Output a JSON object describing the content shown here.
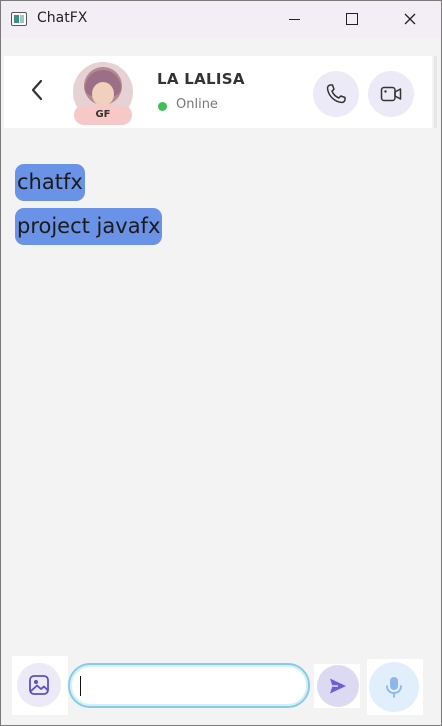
{
  "window": {
    "title": "ChatFX"
  },
  "contact": {
    "name": "LA LALISA",
    "status": "Online",
    "avatar_badge": "GF"
  },
  "messages": [
    {
      "text": "chatfx"
    },
    {
      "text": "project javafx"
    }
  ],
  "composer": {
    "input_value": ""
  },
  "colors": {
    "bubble": "#6a92e6",
    "online": "#3cc15a",
    "icon_accent": "#6b5fd8",
    "input_border": "#84cce9"
  },
  "icons": [
    "back-icon",
    "phone-icon",
    "video-icon",
    "image-icon",
    "send-icon",
    "mic-icon"
  ]
}
